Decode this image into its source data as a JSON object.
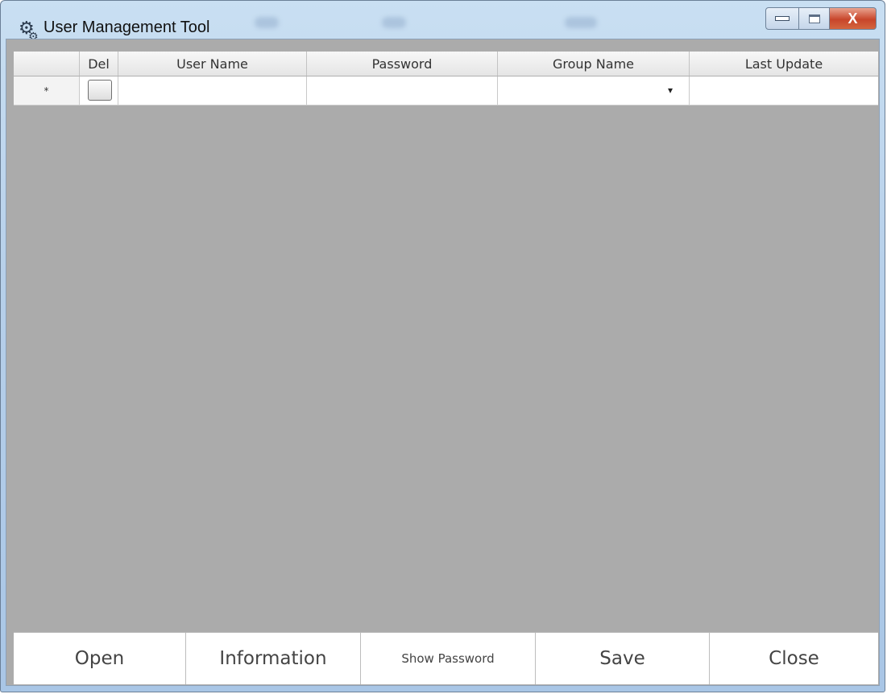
{
  "window": {
    "title": "User Management Tool",
    "close_glyph": "X"
  },
  "grid": {
    "columns": [
      "",
      "Del",
      "User Name",
      "Password",
      "Group Name",
      "Last Update"
    ],
    "new_row_marker": "*",
    "dropdown_glyph": "▾"
  },
  "buttons": {
    "open": "Open",
    "information": "Information",
    "show_password": "Show Password",
    "save": "Save",
    "close": "Close"
  }
}
